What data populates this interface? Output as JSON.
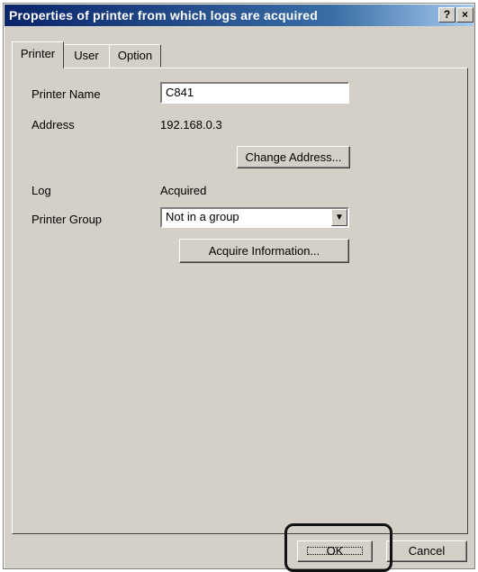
{
  "window": {
    "title": "Properties of printer from which logs are acquired",
    "help_label": "?",
    "close_label": "×"
  },
  "tabs": [
    {
      "label": "Printer",
      "active": true
    },
    {
      "label": "User",
      "active": false
    },
    {
      "label": "Option",
      "active": false
    }
  ],
  "printer": {
    "name_label": "Printer Name",
    "name_value": "C841",
    "address_label": "Address",
    "address_value": "192.168.0.3",
    "change_address_button": "Change Address...",
    "log_label": "Log",
    "log_value": "Acquired",
    "group_label": "Printer Group",
    "group_value": "Not in a group",
    "acquire_button": "Acquire Information..."
  },
  "footer": {
    "ok_label": "OK",
    "cancel_label": "Cancel"
  },
  "icons": {
    "dropdown": "chevron-down-icon"
  }
}
